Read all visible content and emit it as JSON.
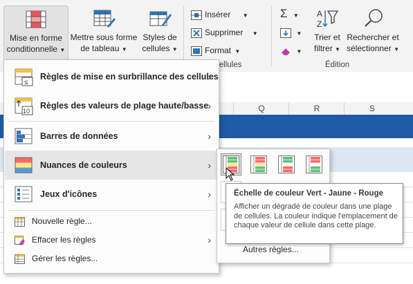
{
  "ribbon": {
    "cond_format": {
      "line1": "Mise en forme",
      "line2": "conditionnelle"
    },
    "format_table": {
      "line1": "Mettre sous forme",
      "line2": "de tableau"
    },
    "cell_styles": {
      "line1": "Styles de",
      "line2": "cellules"
    },
    "cells": {
      "insert": "Insérer",
      "delete": "Supprimer",
      "format": "Format",
      "group_label": "Cellules",
      "group_label_visible": "cellules"
    },
    "editing": {
      "sort_filter": {
        "line1": "Trier et",
        "line2": "filtrer"
      },
      "find_select": {
        "line1": "Rechercher et",
        "line2": "sélectionner"
      },
      "group_label": "Édition"
    }
  },
  "sheet": {
    "columns": [
      "Q",
      "R",
      "S"
    ]
  },
  "menu": {
    "items": [
      {
        "label": "Règles de mise en surbrillance des cellules",
        "icon": "highlight-rules-icon",
        "submenu": true
      },
      {
        "label": "Règles des valeurs de plage haute/basse",
        "icon": "top-bottom-rules-icon",
        "submenu": true
      },
      {
        "label": "Barres de données",
        "icon": "data-bars-icon",
        "submenu": true
      },
      {
        "label": "Nuances de couleurs",
        "icon": "color-scales-icon",
        "submenu": true,
        "hover": true
      },
      {
        "label": "Jeux d'icônes",
        "icon": "icon-sets-icon",
        "submenu": true
      }
    ],
    "small_items": [
      {
        "label": "Nouvelle règle...",
        "icon": "new-rule-icon"
      },
      {
        "label": "Effacer les règles",
        "icon": "clear-rules-icon",
        "submenu": true
      },
      {
        "label": "Gérer les règles...",
        "icon": "manage-rules-icon"
      }
    ]
  },
  "submenu": {
    "swatches": [
      {
        "name": "green-yellow-red-scale",
        "colors": [
          "#63be7b",
          "#ffeb84",
          "#f8696b"
        ],
        "selected": true
      },
      {
        "name": "red-yellow-green-scale",
        "colors": [
          "#f8696b",
          "#ffeb84",
          "#63be7b"
        ]
      },
      {
        "name": "green-white-red-scale",
        "colors": [
          "#63be7b",
          "#fcfcff",
          "#f8696b"
        ]
      },
      {
        "name": "red-white-green-scale",
        "colors": [
          "#f8696b",
          "#fcfcff",
          "#63be7b"
        ]
      }
    ],
    "more_rules": "Autres règles..."
  },
  "tooltip": {
    "title": "Échelle de couleur Vert - Jaune - Rouge",
    "body": "Afficher un dégradé de couleur dans une plage de cellules. La couleur indique l'emplacement de chaque valeur de cellule dans cette plage."
  },
  "colors": {
    "ribbon_bg": "#f3f3f3",
    "header_blue": "#1f5aa6",
    "hover": "#e6e6e6",
    "green": "#63be7b",
    "yellow": "#ffeb84",
    "red": "#f8696b"
  }
}
